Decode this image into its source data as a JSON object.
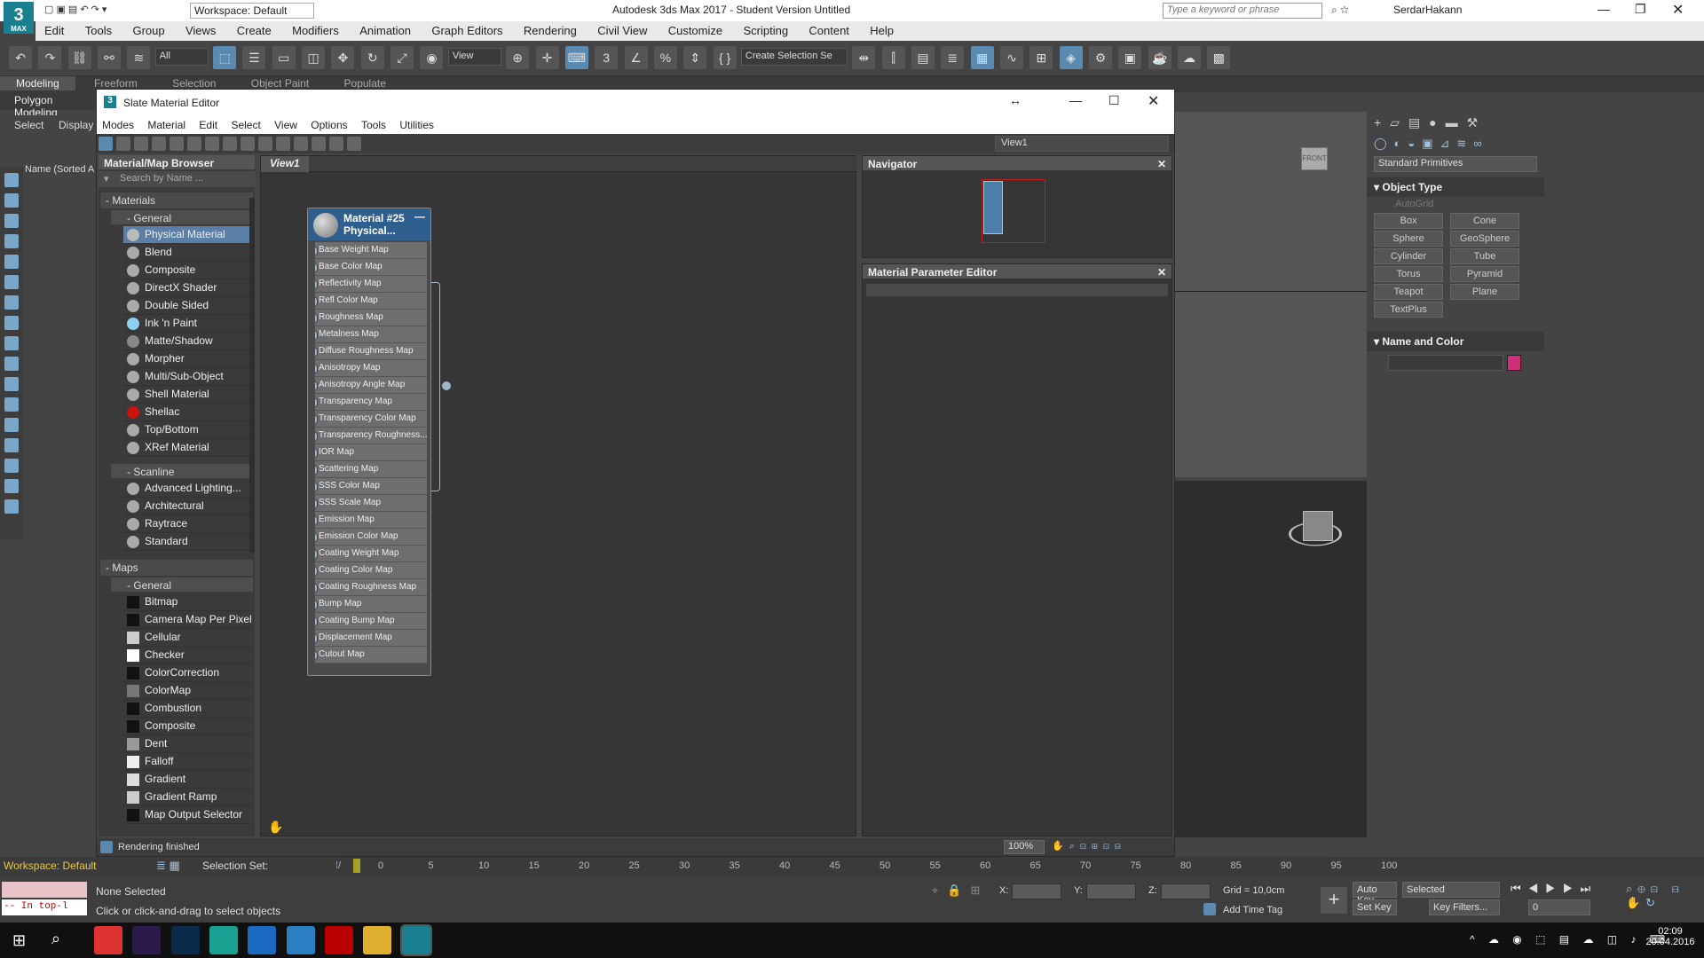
{
  "app": {
    "logo_text": "3",
    "logo_sub": "MAX",
    "workspace_top": "Workspace: Default",
    "title": "Autodesk 3ds Max 2017 - Student Version    Untitled",
    "search_placeholder": "Type a keyword or phrase",
    "user": "SerdarHakann"
  },
  "menu": [
    "Edit",
    "Tools",
    "Group",
    "Views",
    "Create",
    "Modifiers",
    "Animation",
    "Graph Editors",
    "Rendering",
    "Civil View",
    "Customize",
    "Scripting",
    "Content",
    "Help"
  ],
  "toolbar": {
    "filter": "All",
    "view_dropdown": "View",
    "selection_set": "Create Selection Se"
  },
  "ribbon": {
    "tabs": [
      "Modeling",
      "Freeform",
      "Selection",
      "Object Paint",
      "Populate"
    ],
    "sub": "Polygon Modeling"
  },
  "scene_explorer": {
    "tabs": [
      "Select",
      "Display"
    ],
    "header": "Name (Sorted A"
  },
  "slate": {
    "title": "Slate Material Editor",
    "menu": [
      "Modes",
      "Material",
      "Edit",
      "Select",
      "View",
      "Options",
      "Tools",
      "Utilities"
    ],
    "view_dropdown": "View1",
    "browser_title": "Material/Map Browser",
    "search_placeholder": "Search by Name ...",
    "materials_label": "- Materials",
    "general_label": "- General",
    "general_items": [
      {
        "name": "Physical Material",
        "color": "#bbbbbb",
        "selected": true
      },
      {
        "name": "Blend",
        "color": "#aaaaaa"
      },
      {
        "name": "Composite",
        "color": "#aaaaaa"
      },
      {
        "name": "DirectX Shader",
        "color": "#aaaaaa"
      },
      {
        "name": "Double Sided",
        "color": "#aaaaaa"
      },
      {
        "name": "Ink 'n Paint",
        "color": "#8fd0f0"
      },
      {
        "name": "Matte/Shadow",
        "color": "#888888"
      },
      {
        "name": "Morpher",
        "color": "#aaaaaa"
      },
      {
        "name": "Multi/Sub-Object",
        "color": "#aaaaaa"
      },
      {
        "name": "Shell Material",
        "color": "#aaaaaa"
      },
      {
        "name": "Shellac",
        "color": "#cc1111"
      },
      {
        "name": "Top/Bottom",
        "color": "#aaaaaa"
      },
      {
        "name": "XRef Material",
        "color": "#aaaaaa"
      }
    ],
    "scanline_label": "- Scanline",
    "scanline_items": [
      "Advanced Lighting...",
      "Architectural",
      "Raytrace",
      "Standard"
    ],
    "maps_label": "- Maps",
    "maps_general_label": "- General",
    "map_items": [
      {
        "name": "Bitmap",
        "color": "#111111"
      },
      {
        "name": "Camera Map Per Pixel",
        "color": "#111111"
      },
      {
        "name": "Cellular",
        "color": "#cccccc"
      },
      {
        "name": "Checker",
        "color": "#ffffff"
      },
      {
        "name": "ColorCorrection",
        "color": "#111111"
      },
      {
        "name": "ColorMap",
        "color": "#777777"
      },
      {
        "name": "Combustion",
        "color": "#111111"
      },
      {
        "name": "Composite",
        "color": "#111111"
      },
      {
        "name": "Dent",
        "color": "#999999"
      },
      {
        "name": "Falloff",
        "color": "#eeeeee"
      },
      {
        "name": "Gradient",
        "color": "#dddddd"
      },
      {
        "name": "Gradient Ramp",
        "color": "#cccccc"
      },
      {
        "name": "Map Output Selector",
        "color": "#111111"
      }
    ],
    "view_tab": "View1",
    "node_title": "Material #25",
    "node_sub": "Physical...",
    "node_slots": [
      "Base Weight Map",
      "Base Color Map",
      "Reflectivity Map",
      "Refl Color Map",
      "Roughness Map",
      "Metalness Map",
      "Diffuse Roughness Map",
      "Anisotropy Map",
      "Anisotropy Angle Map",
      "Transparency Map",
      "Transparency Color Map",
      "Transparency Roughness...",
      "IOR Map",
      "Scattering Map",
      "SSS Color Map",
      "SSS Scale Map",
      "Emission Map",
      "Emission Color Map",
      "Coating Weight Map",
      "Coating Color Map",
      "Coating Roughness Map",
      "Bump Map",
      "Coating Bump Map",
      "Displacement Map",
      "Cutout Map"
    ],
    "navigator_title": "Navigator",
    "param_editor_title": "Material Parameter Editor",
    "status": "Rendering finished",
    "zoom": "100%"
  },
  "command_panel": {
    "category": "Standard Primitives",
    "object_type": "Object Type",
    "autogrid": "AutoGrid",
    "buttons": [
      "Box",
      "Cone",
      "Sphere",
      "GeoSphere",
      "Cylinder",
      "Tube",
      "Torus",
      "Pyramid",
      "Teapot",
      "Plane",
      "TextPlus"
    ],
    "name_color": "Name and Color",
    "color_swatch": "#d0307a"
  },
  "bottom": {
    "workspace": "Workspace: Default",
    "selection_set": "Selection Set:",
    "timeline_ticks": [
      "0",
      "5",
      "10",
      "15",
      "20",
      "25",
      "30",
      "35",
      "40",
      "45",
      "50",
      "55",
      "60",
      "65",
      "70",
      "75",
      "80",
      "85",
      "90",
      "95",
      "100"
    ],
    "maxscript": "-- In top-l",
    "none_selected": "None Selected",
    "prompt": "Click or click-and-drag to select objects",
    "x_label": "X:",
    "y_label": "Y:",
    "z_label": "Z:",
    "grid": "Grid = 10,0cm",
    "add_time_tag": "Add Time Tag",
    "auto_key": "Auto Key",
    "set_key": "Set Key",
    "selected": "Selected",
    "key_filters": "Key Filters...",
    "frame": "0"
  },
  "taskbar": {
    "time": "02:09",
    "date": "20.04.2016"
  }
}
